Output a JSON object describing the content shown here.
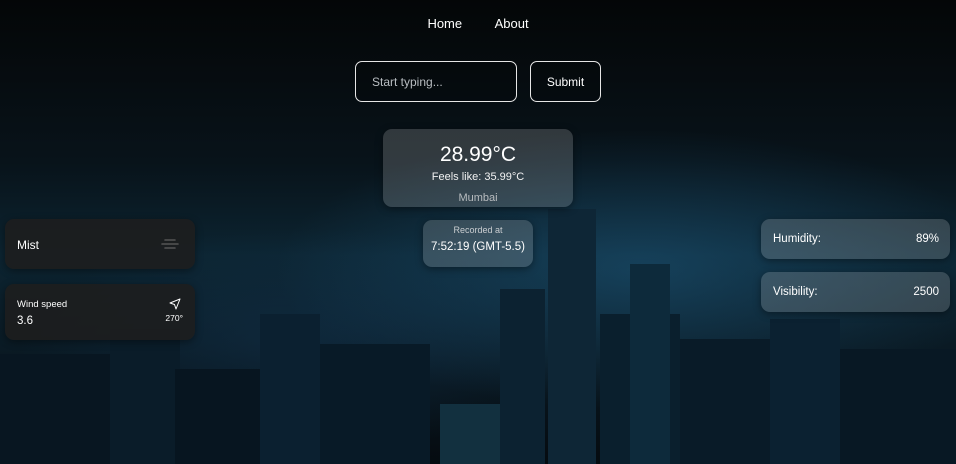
{
  "nav": {
    "items": [
      {
        "label": "Home"
      },
      {
        "label": "About"
      }
    ]
  },
  "search": {
    "placeholder": "Start typing...",
    "value": "",
    "submit_label": "Submit"
  },
  "current": {
    "temperature": "28.99°C",
    "feels_like": "Feels like: 35.99°C",
    "city": "Mumbai"
  },
  "recorded": {
    "label": "Recorded at",
    "time": "7:52:19 (GMT-5.5)"
  },
  "condition": {
    "label": "Mist",
    "icon": "mist-icon"
  },
  "wind": {
    "label": "Wind speed",
    "value": "3.6",
    "direction": "270°",
    "icon": "navigation-arrow-icon"
  },
  "humidity": {
    "label": "Humidity:",
    "value": "89%"
  },
  "visibility": {
    "label": "Visibility:",
    "value": "2500"
  }
}
